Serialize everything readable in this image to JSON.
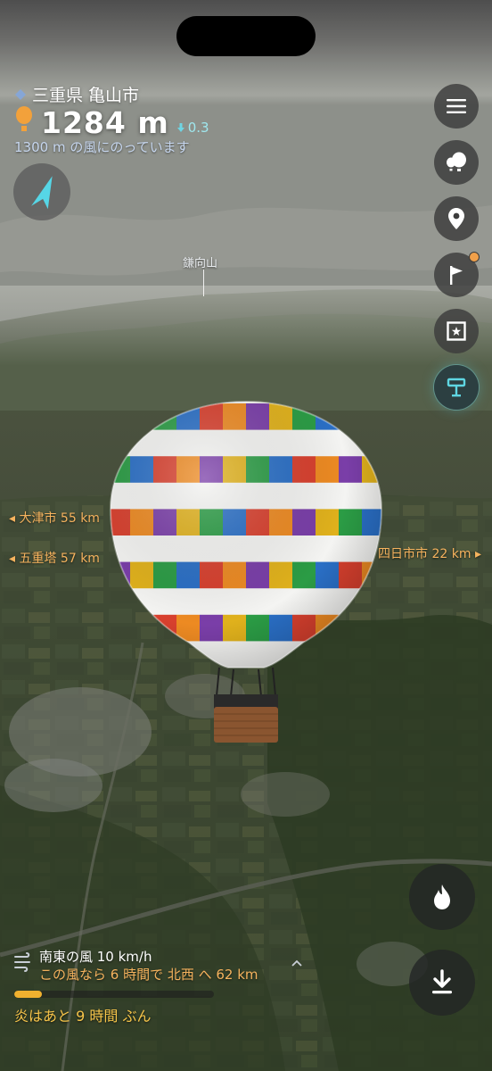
{
  "location": {
    "name": "三重県 亀山市"
  },
  "altitude": {
    "value": "1284 m",
    "rate": "0.3",
    "wind_layer_text": "1300 m の風にのっています"
  },
  "map_labels": {
    "mountain": "鎌向山",
    "left_1": "大津市 55 km",
    "left_2": "五重塔 57 km",
    "right_1": "四日市市 22 km"
  },
  "wind": {
    "direction_text": "南東の風 10 km/h",
    "forecast_text": "この風なら 6 時間で 北西 へ 62 km"
  },
  "fuel": {
    "remaining_text": "炎はあと 9 時間 ぶん",
    "fraction": 0.14
  },
  "side_buttons": [
    "menu-icon",
    "balloons-icon",
    "map-pin-icon",
    "flag-icon",
    "photo-frame-icon",
    "mailbox-icon"
  ],
  "bottom_buttons": [
    "flame-icon",
    "download-icon"
  ],
  "colors": {
    "accent_orange": "#f6b35e",
    "fuel_yellow": "#f0b12f",
    "active_cyan": "#5fd6e2"
  }
}
